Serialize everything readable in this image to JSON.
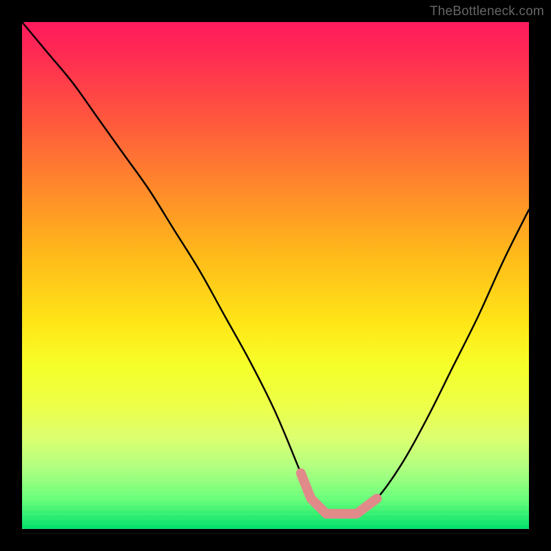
{
  "watermark": "TheBottleneck.com",
  "colors": {
    "gradient_top": "#ff1a5e",
    "gradient_bottom": "#00e06a",
    "curve": "#000000",
    "flat_marker": "#e08a8a",
    "page_background": "#000000"
  },
  "chart_data": {
    "type": "line",
    "title": "",
    "xlabel": "",
    "ylabel": "",
    "xlim": [
      0,
      100
    ],
    "ylim": [
      0,
      100
    ],
    "series": [
      {
        "name": "bottleneck_curve",
        "x": [
          0,
          5,
          10,
          15,
          20,
          25,
          30,
          35,
          40,
          45,
          50,
          55,
          57,
          60,
          63,
          66,
          70,
          75,
          80,
          85,
          90,
          95,
          100
        ],
        "values": [
          100,
          94,
          88,
          81,
          74,
          67,
          59,
          51,
          42,
          33,
          23,
          11,
          6,
          3,
          3,
          3,
          6,
          13,
          22,
          32,
          42,
          53,
          63
        ]
      }
    ],
    "annotations": [
      {
        "name": "valley_flat_segment",
        "x_start": 55,
        "x_end": 70,
        "y": 4,
        "style": "thick-rounded",
        "color": "#e08a8a"
      }
    ]
  }
}
